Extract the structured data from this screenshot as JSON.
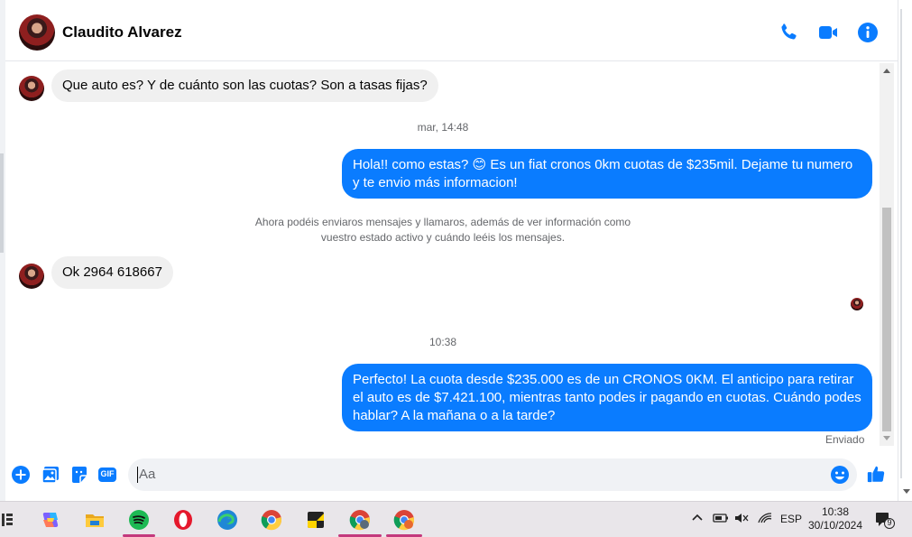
{
  "chat": {
    "contact_name": "Claudito Alvarez",
    "header_icons": [
      "phone-icon",
      "video-icon",
      "info-icon"
    ],
    "messages": [
      {
        "side": "in",
        "text": "Que auto es? Y de cuánto son las cuotas? Son a tasas fijas?"
      },
      {
        "side": "ts",
        "text": "mar, 14:48"
      },
      {
        "side": "out",
        "text": "Hola!! como estas? 😊 Es un fiat cronos 0km cuotas de $235mil. Dejame tu numero y te envio más informacion!"
      },
      {
        "side": "notice",
        "text": "Ahora podéis enviaros mensajes y llamaros, además de ver información como vuestro estado activo y cuándo leéis los mensajes."
      },
      {
        "side": "in",
        "text": "Ok 2964 618667"
      },
      {
        "side": "ts",
        "text": "10:38"
      },
      {
        "side": "out",
        "text": "Perfecto! La cuota desde $235.000 es de un CRONOS 0KM. El anticipo para retirar el auto es de $7.421.100, mientras tanto podes ir pagando en cuotas. Cuándo podes hablar? A la mañana o a la tarde?"
      }
    ],
    "status": "Enviado"
  },
  "composer": {
    "placeholder": "Aa",
    "icons": [
      "plus-icon",
      "image-icon",
      "sticker-icon",
      "gif-icon",
      "emoji-icon",
      "thumbs-up-icon"
    ],
    "gif_label": "GIF"
  },
  "taskbar": {
    "apps": [
      "task-view-icon",
      "copilot-icon",
      "file-explorer-icon",
      "spotify-icon",
      "opera-icon",
      "edge-icon",
      "chrome-icon",
      "sticky-notes-icon",
      "chrome-profile-icon",
      "chrome-profile-2-icon"
    ],
    "language": "ESP",
    "time": "10:38",
    "date": "30/10/2024",
    "notification_count": "9"
  },
  "colors": {
    "accent": "#0a7cff",
    "incoming_bubble": "#f0f0f0",
    "taskbar": "#e9e6ea"
  }
}
